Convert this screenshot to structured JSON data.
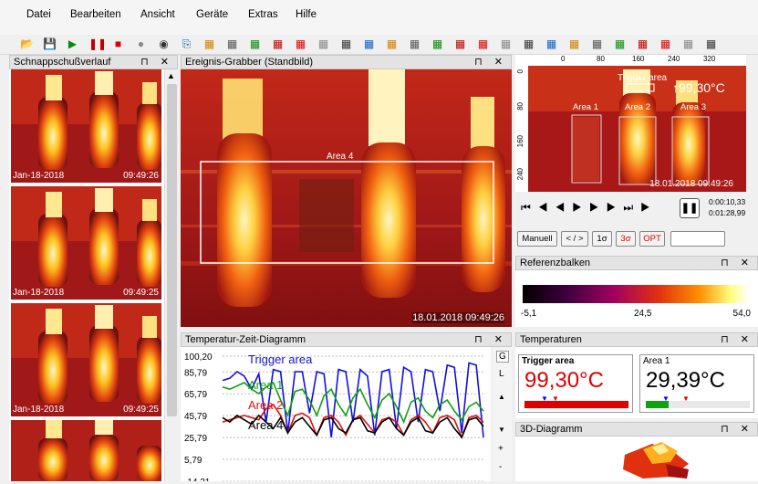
{
  "menu": [
    "Datei",
    "Bearbeiten",
    "Ansicht",
    "Geräte",
    "Extras",
    "Hilfe"
  ],
  "toolbar_icons": [
    "open-icon",
    "save-icon",
    "play-icon",
    "pause-icon",
    "stop-icon",
    "record-icon",
    "camera-icon",
    "copy-icon",
    "grid-icon",
    "grid2-icon",
    "layout-icon",
    "layout2-icon",
    "measure-icon",
    "histogram-icon",
    "profile-icon",
    "palette-icon",
    "line-icon",
    "area-icon",
    "chart-icon",
    "table-icon",
    "dashes-icon",
    "minmax-icon",
    "hand-icon",
    "zoom-fit-icon",
    "image-icon",
    "bar-icon",
    "bar2-icon",
    "tools-icon",
    "flame-icon",
    "pin-icon",
    "calibrate-icon"
  ],
  "panels": {
    "snapshots": {
      "title": "Schnappschußverlauf",
      "ctl": "⊓ ✕"
    },
    "grabber": {
      "title": "Ereignis-Grabber (Standbild)",
      "ctl": "⊓ ✕"
    },
    "timechart": {
      "title": "Temperatur-Zeit-Diagramm",
      "ctl": "⊓ ✕"
    },
    "refbar": {
      "title": "Referenzbalken",
      "ctl": "⊓ ✕"
    },
    "temps": {
      "title": "Temperaturen",
      "ctl": "⊓ ✕"
    },
    "diagram3d": {
      "title": "3D-Diagramm",
      "ctl": "⊓ ✕"
    }
  },
  "snapshots": [
    {
      "date": "Jan-18-2018",
      "time": "09:49:26"
    },
    {
      "date": "Jan-18-2018",
      "time": "09:49:25"
    },
    {
      "date": "Jan-18-2018",
      "time": "09:49:25"
    },
    {
      "date": "",
      "time": ""
    }
  ],
  "grabber": {
    "area_label": "Area 4",
    "timestamp": "18.01.2018 09:49:26"
  },
  "live": {
    "ruler": [
      "0",
      "80",
      "160",
      "240",
      "320"
    ],
    "vruler": [
      "0",
      "80",
      "160",
      "240"
    ],
    "trigger_label": "Trigger area",
    "max_temp": "↑99,30°C",
    "areas": [
      "Area 1",
      "Area 2",
      "Area 3"
    ],
    "timestamp": "18.01.2018 09:49:26",
    "time_elapsed": "0:00:10,33",
    "time_total": "0:01:28,99",
    "buttons": [
      "Manuell",
      "< / >",
      "1σ",
      "3σ",
      "OPT"
    ]
  },
  "refbar": {
    "min": "-5,1",
    "mid": "24,5",
    "max": "54,0"
  },
  "temps": [
    {
      "label": "Trigger area",
      "value": "99,30°C",
      "color": "#e00000"
    },
    {
      "label": "Area 1",
      "value": "29,39°C",
      "color": "#000000"
    }
  ],
  "side_tabs": [
    "G",
    "L",
    "▲",
    "▼",
    "+",
    "-"
  ],
  "chart_data": {
    "type": "line",
    "yticks": [
      "100,20",
      "85,79",
      "65,79",
      "45,79",
      "25,79",
      "5,79",
      "-14,21"
    ],
    "ylim": [
      -14.21,
      100.2
    ],
    "series": [
      {
        "name": "Trigger area",
        "color": "#1010e0",
        "values": [
          78,
          80,
          86,
          82,
          70,
          84,
          40,
          88,
          86,
          30,
          86,
          86,
          48,
          86,
          84,
          26,
          88,
          86,
          40,
          88,
          82,
          28,
          86,
          88,
          34,
          90,
          86,
          40,
          88,
          86,
          50,
          92,
          90,
          30,
          94,
          92,
          26
        ]
      },
      {
        "name": "Area 1",
        "color": "#10a010",
        "values": [
          72,
          70,
          73,
          76,
          70,
          66,
          72,
          76,
          60,
          46,
          68,
          70,
          60,
          46,
          64,
          70,
          56,
          46,
          62,
          70,
          56,
          44,
          60,
          66,
          54,
          40,
          58,
          62,
          50,
          44,
          56,
          60,
          50,
          42,
          54,
          58,
          50
        ]
      },
      {
        "name": "Area 2",
        "color": "#e01010",
        "values": [
          40,
          42,
          44,
          46,
          44,
          42,
          52,
          56,
          46,
          30,
          46,
          48,
          44,
          28,
          44,
          46,
          40,
          28,
          42,
          46,
          38,
          30,
          42,
          44,
          40,
          28,
          42,
          46,
          40,
          30,
          44,
          46,
          42,
          26,
          44,
          46,
          40
        ]
      },
      {
        "name": "Area 4",
        "color": "#000000",
        "values": [
          44,
          40,
          46,
          42,
          38,
          46,
          40,
          34,
          44,
          30,
          40,
          44,
          36,
          28,
          42,
          44,
          34,
          30,
          42,
          44,
          32,
          30,
          40,
          44,
          34,
          28,
          40,
          44,
          32,
          30,
          40,
          44,
          34,
          26,
          42,
          44,
          36
        ]
      }
    ]
  }
}
